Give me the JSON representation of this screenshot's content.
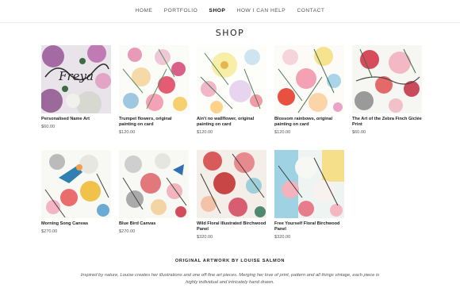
{
  "nav": {
    "items": [
      {
        "label": "HOME",
        "active": false
      },
      {
        "label": "PORTFOLIO",
        "active": false
      },
      {
        "label": "SHOP",
        "active": true
      },
      {
        "label": "HOW I CAN HELP",
        "active": false
      },
      {
        "label": "CONTACT",
        "active": false
      }
    ]
  },
  "page": {
    "title": "SHOP"
  },
  "products": [
    {
      "title": "Personalised Name Art",
      "price": "$60.00",
      "name_text": "Freya"
    },
    {
      "title": "Trumpet flowers, original painting on card",
      "price": "$120.00"
    },
    {
      "title": "Ain't no wallflower, original painting on card",
      "price": "$120.00"
    },
    {
      "title": "Blossom rainbows, original painting on card",
      "price": "$120.00"
    },
    {
      "title": "The Art of the Zebra Finch Giclée Print",
      "price": "$60.00"
    },
    {
      "title": "Morning Song Canvas",
      "price": "$270.00"
    },
    {
      "title": "Blue Bird Canvas",
      "price": "$270.00"
    },
    {
      "title": "Wild Floral Illustrated Birchwood Panel",
      "price": "$320.00"
    },
    {
      "title": "Free Yourself Floral Birchwood Panel",
      "price": "$320.00"
    }
  ],
  "footer": {
    "title": "ORIGINAL ARTWORK BY LOUISE SALMON",
    "text": "Inspired by nature, Louise creates her illustrations and one off fine art pieces. Merging her love of print, pattern and all things vintage, each piece is highly individual and intricately hand drawn."
  }
}
